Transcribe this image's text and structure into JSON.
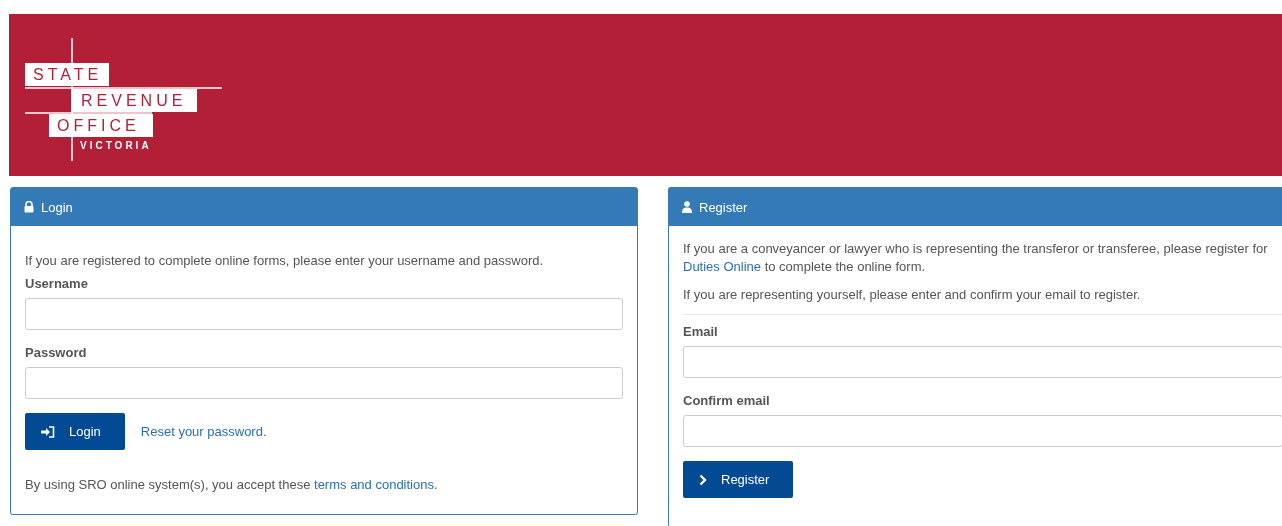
{
  "logo": {
    "lines": [
      "STATE",
      "REVENUE",
      "OFFICE"
    ],
    "tagline": "VICTORIA"
  },
  "login": {
    "title": "Login",
    "intro": "If you are registered to complete online forms, please enter your username and password.",
    "fields": [
      {
        "label": "Username"
      },
      {
        "label": "Password"
      }
    ],
    "button": "Login",
    "reset_link": "Reset your password.",
    "terms_before": "By using SRO online system(s), you accept these ",
    "terms_link": "terms and conditions",
    "terms_after": "."
  },
  "register": {
    "title": "Register",
    "intro_before": "If you are a conveyancer or lawyer who is representing the transferor or transferee, please register for ",
    "intro_link": "Duties Online",
    "intro_after": " to complete the online form.",
    "note": "If you are representing yourself, please enter and confirm your email to register.",
    "fields": [
      {
        "label": "Email"
      },
      {
        "label": "Confirm email"
      }
    ],
    "button": "Register"
  }
}
